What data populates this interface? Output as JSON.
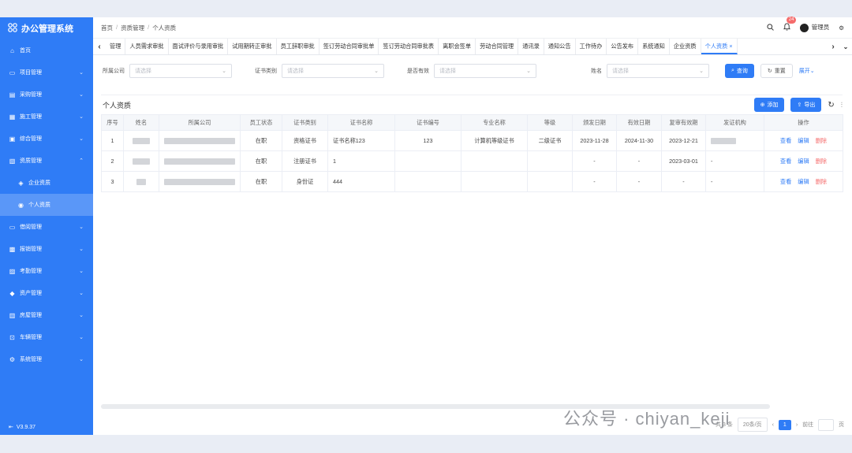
{
  "app": {
    "title": "办公管理系统",
    "version": "V3.9.37"
  },
  "sidebar": {
    "items": [
      {
        "label": "首页",
        "icon": "home-icon"
      },
      {
        "label": "项目管理"
      },
      {
        "label": "采购管理"
      },
      {
        "label": "施工管理"
      },
      {
        "label": "综合管理"
      },
      {
        "label": "资质管理",
        "expanded": true
      },
      {
        "label": "企业资质",
        "sub": true
      },
      {
        "label": "个人资质",
        "sub": true,
        "active": true
      },
      {
        "label": "借阅管理"
      },
      {
        "label": "报销管理"
      },
      {
        "label": "考勤管理"
      },
      {
        "label": "资产管理"
      },
      {
        "label": "房屋管理"
      },
      {
        "label": "车辆管理"
      },
      {
        "label": "系统管理"
      }
    ]
  },
  "header": {
    "breadcrumb": [
      "首页",
      "资质管理",
      "个人资质"
    ],
    "badge": "24",
    "user": "管理员"
  },
  "tabs": [
    "管理",
    "人员需求审批",
    "面试评价与录用审批",
    "试用期转正审批",
    "员工辞职审批",
    "签订劳动合同审批单",
    "签订劳动合同审批表",
    "离职会签单",
    "劳动合同管理",
    "通讯录",
    "通知公告",
    "工作待办",
    "公告发布",
    "系统通知",
    "企业资质",
    "个人资质 ×"
  ],
  "active_tab_index": 15,
  "filters": {
    "company": {
      "label": "所属公司",
      "placeholder": "请选择"
    },
    "cert_type": {
      "label": "证书类别",
      "placeholder": "请选择"
    },
    "valid": {
      "label": "是否有效",
      "placeholder": "请选择"
    },
    "name": {
      "label": "姓名",
      "placeholder": "请选择"
    },
    "query_btn": "查询",
    "reset_btn": "重置",
    "expand_link": "展开"
  },
  "panel": {
    "title": "个人资质",
    "add_btn": "添加",
    "export_btn": "导出"
  },
  "table": {
    "headers": [
      "序号",
      "姓名",
      "所属公司",
      "员工状态",
      "证书类别",
      "证书名称",
      "证书编号",
      "专业名称",
      "等级",
      "颁发日期",
      "有效日期",
      "复审有效期",
      "发证机构",
      "操作"
    ],
    "rows": [
      {
        "no": "1",
        "status": "在职",
        "type": "资格证书",
        "cert_name": "证书名称123",
        "cert_no": "123",
        "major": "计算机等级证书",
        "level": "二级证书",
        "issue": "2023-11-28",
        "valid": "2024-11-30",
        "review": "2023-12-21",
        "org": ""
      },
      {
        "no": "2",
        "status": "在职",
        "type": "注册证书",
        "cert_name": "1",
        "cert_no": "",
        "major": "",
        "level": "",
        "issue": "-",
        "valid": "-",
        "review": "2023-03-01",
        "org": "-"
      },
      {
        "no": "3",
        "status": "在职",
        "type": "身份证",
        "cert_name": "444",
        "cert_no": "",
        "major": "",
        "level": "",
        "issue": "-",
        "valid": "-",
        "review": "-",
        "org": "-"
      }
    ],
    "actions": {
      "view": "查看",
      "edit": "编辑",
      "delete": "删除"
    }
  },
  "pager": {
    "total": "共 3 条",
    "page_size": "20条/页",
    "current": "1",
    "goto": "前往",
    "page_unit": "页"
  },
  "watermark": "公众号 · chiyan_keji"
}
